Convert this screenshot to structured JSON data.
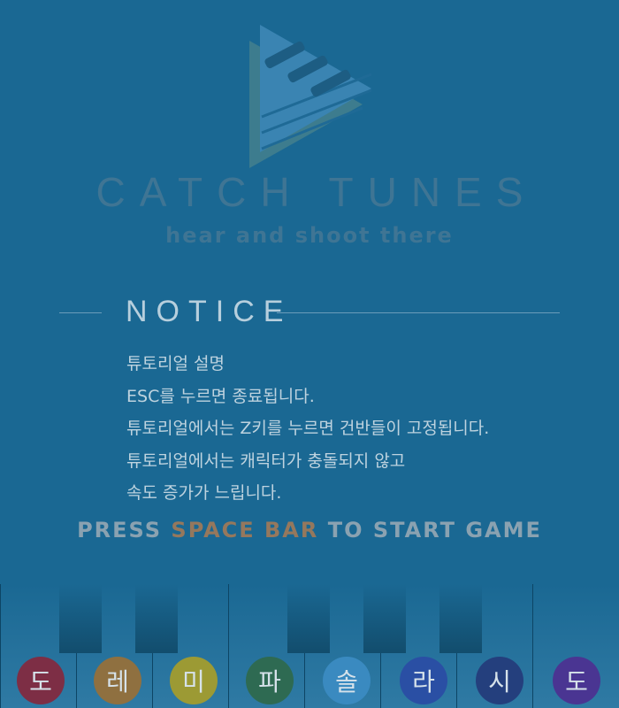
{
  "game": {
    "title": "CATCH TUNES",
    "subtitle": "hear and shoot there"
  },
  "notice": {
    "heading": "NOTICE",
    "lines": [
      "튜토리얼 설명",
      "ESC를 누르면 종료됩니다.",
      "튜토리얼에서는 Z키를 누르면 건반들이 고정됩니다.",
      "튜토리얼에서는 캐릭터가 충돌되지 않고",
      "속도 증가가 느립니다."
    ]
  },
  "prompt": {
    "before": "PRESS ",
    "highlight": "SPACE BAR",
    "after": " TO START GAME"
  },
  "notes": [
    {
      "label": "도",
      "color": "#7d2e45"
    },
    {
      "label": "레",
      "color": "#8f7040"
    },
    {
      "label": "미",
      "color": "#9c9a34"
    },
    {
      "label": "파",
      "color": "#2e6a52"
    },
    {
      "label": "솔",
      "color": "#3a8ac0"
    },
    {
      "label": "라",
      "color": "#2a4fa4"
    },
    {
      "label": "시",
      "color": "#243f7d"
    },
    {
      "label": "도",
      "color": "#4a3592"
    }
  ],
  "colors": {
    "background": "#1a6893",
    "accent": "#95785d"
  }
}
